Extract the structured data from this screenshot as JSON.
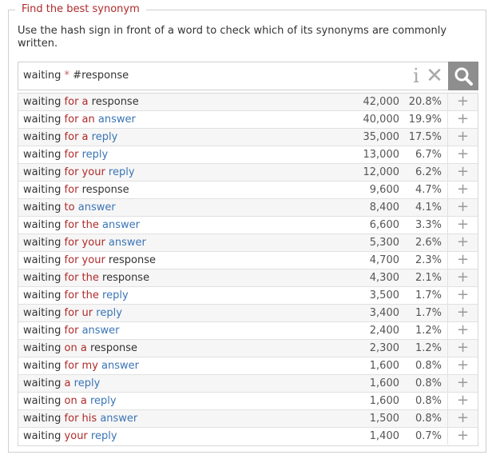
{
  "panel": {
    "legend": "Find the best synonym",
    "hint": "Use the hash sign in front of a word to check which of its synonyms are commonly written."
  },
  "search": {
    "query_before": "waiting ",
    "query_star": "*",
    "query_after": " #response",
    "info_glyph": "i",
    "clear_glyph": "✕",
    "icons": {
      "info": "info-icon",
      "clear": "close-icon",
      "search": "search-icon"
    }
  },
  "colors": {
    "function_word": "#b02a2a",
    "synonym_word": "#3a74b5",
    "search_button": "#8e8e8e"
  },
  "results": [
    {
      "parts": [
        [
          "waiting ",
          "b"
        ],
        [
          "for a ",
          "f"
        ],
        [
          "response",
          "b"
        ]
      ],
      "count": "42,000",
      "pct": "20.8%"
    },
    {
      "parts": [
        [
          "waiting ",
          "b"
        ],
        [
          "for an ",
          "f"
        ],
        [
          "answer",
          "s"
        ]
      ],
      "count": "40,000",
      "pct": "19.9%"
    },
    {
      "parts": [
        [
          "waiting ",
          "b"
        ],
        [
          "for a ",
          "f"
        ],
        [
          "reply",
          "s"
        ]
      ],
      "count": "35,000",
      "pct": "17.5%"
    },
    {
      "parts": [
        [
          "waiting ",
          "b"
        ],
        [
          "for ",
          "f"
        ],
        [
          "reply",
          "s"
        ]
      ],
      "count": "13,000",
      "pct": "6.7%"
    },
    {
      "parts": [
        [
          "waiting ",
          "b"
        ],
        [
          "for your ",
          "f"
        ],
        [
          "reply",
          "s"
        ]
      ],
      "count": "12,000",
      "pct": "6.2%"
    },
    {
      "parts": [
        [
          "waiting ",
          "b"
        ],
        [
          "for ",
          "f"
        ],
        [
          "response",
          "b"
        ]
      ],
      "count": "9,600",
      "pct": "4.7%"
    },
    {
      "parts": [
        [
          "waiting ",
          "b"
        ],
        [
          "to ",
          "f"
        ],
        [
          "answer",
          "s"
        ]
      ],
      "count": "8,400",
      "pct": "4.1%"
    },
    {
      "parts": [
        [
          "waiting ",
          "b"
        ],
        [
          "for the ",
          "f"
        ],
        [
          "answer",
          "s"
        ]
      ],
      "count": "6,600",
      "pct": "3.3%"
    },
    {
      "parts": [
        [
          "waiting ",
          "b"
        ],
        [
          "for your ",
          "f"
        ],
        [
          "answer",
          "s"
        ]
      ],
      "count": "5,300",
      "pct": "2.6%"
    },
    {
      "parts": [
        [
          "waiting ",
          "b"
        ],
        [
          "for your ",
          "f"
        ],
        [
          "response",
          "b"
        ]
      ],
      "count": "4,700",
      "pct": "2.3%"
    },
    {
      "parts": [
        [
          "waiting ",
          "b"
        ],
        [
          "for the ",
          "f"
        ],
        [
          "response",
          "b"
        ]
      ],
      "count": "4,300",
      "pct": "2.1%"
    },
    {
      "parts": [
        [
          "waiting ",
          "b"
        ],
        [
          "for the ",
          "f"
        ],
        [
          "reply",
          "s"
        ]
      ],
      "count": "3,500",
      "pct": "1.7%"
    },
    {
      "parts": [
        [
          "waiting ",
          "b"
        ],
        [
          "for ur ",
          "f"
        ],
        [
          "reply",
          "s"
        ]
      ],
      "count": "3,400",
      "pct": "1.7%"
    },
    {
      "parts": [
        [
          "waiting ",
          "b"
        ],
        [
          "for ",
          "f"
        ],
        [
          "answer",
          "s"
        ]
      ],
      "count": "2,400",
      "pct": "1.2%"
    },
    {
      "parts": [
        [
          "waiting ",
          "b"
        ],
        [
          "on a ",
          "f"
        ],
        [
          "response",
          "b"
        ]
      ],
      "count": "2,300",
      "pct": "1.2%"
    },
    {
      "parts": [
        [
          "waiting ",
          "b"
        ],
        [
          "for my ",
          "f"
        ],
        [
          "answer",
          "s"
        ]
      ],
      "count": "1,600",
      "pct": "0.8%"
    },
    {
      "parts": [
        [
          "waiting ",
          "b"
        ],
        [
          "a ",
          "f"
        ],
        [
          "reply",
          "s"
        ]
      ],
      "count": "1,600",
      "pct": "0.8%"
    },
    {
      "parts": [
        [
          "waiting ",
          "b"
        ],
        [
          "on a ",
          "f"
        ],
        [
          "reply",
          "s"
        ]
      ],
      "count": "1,600",
      "pct": "0.8%"
    },
    {
      "parts": [
        [
          "waiting ",
          "b"
        ],
        [
          "for his ",
          "f"
        ],
        [
          "answer",
          "s"
        ]
      ],
      "count": "1,500",
      "pct": "0.8%"
    },
    {
      "parts": [
        [
          "waiting ",
          "b"
        ],
        [
          "your ",
          "f"
        ],
        [
          "reply",
          "s"
        ]
      ],
      "count": "1,400",
      "pct": "0.7%"
    }
  ],
  "row_action": {
    "glyph": "+",
    "icon": "plus-icon"
  }
}
